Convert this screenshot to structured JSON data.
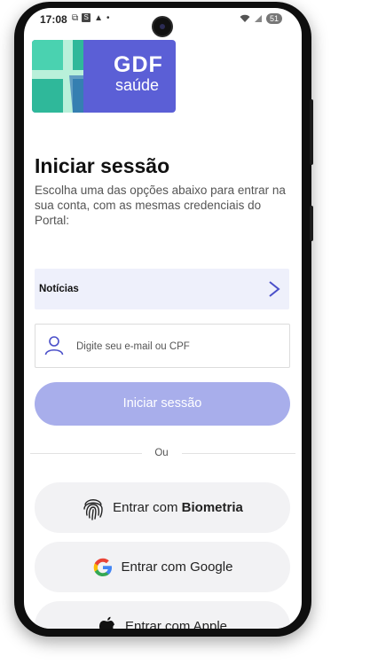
{
  "status_bar": {
    "time": "17:08",
    "left_icons": [
      "screenshot-icon",
      "s-app-icon",
      "alert-icon",
      "dot-icon"
    ],
    "battery": "51"
  },
  "logo": {
    "line1": "GDF",
    "line2": "saúde"
  },
  "login": {
    "title": "Iniciar sessão",
    "subtitle": "Escolha uma das opções abaixo para entrar na sua conta, com as mesmas credenciais do Portal:"
  },
  "news": {
    "label": "Notícias"
  },
  "input": {
    "placeholder": "Digite seu e-mail ou CPF",
    "value": ""
  },
  "primary_button": {
    "label": "Iniciar sessão"
  },
  "divider": {
    "label": "Ou"
  },
  "social": {
    "biometry_prefix": "Entrar com ",
    "biometry_bold": "Biometria",
    "google_label": "Entrar com Google",
    "apple_label": "Entrar com Apple"
  },
  "colors": {
    "brand": "#5b5fd6",
    "primary_disabled": "#a8aeeb",
    "news_bg": "#eef0fb",
    "social_bg": "#f2f2f4"
  }
}
